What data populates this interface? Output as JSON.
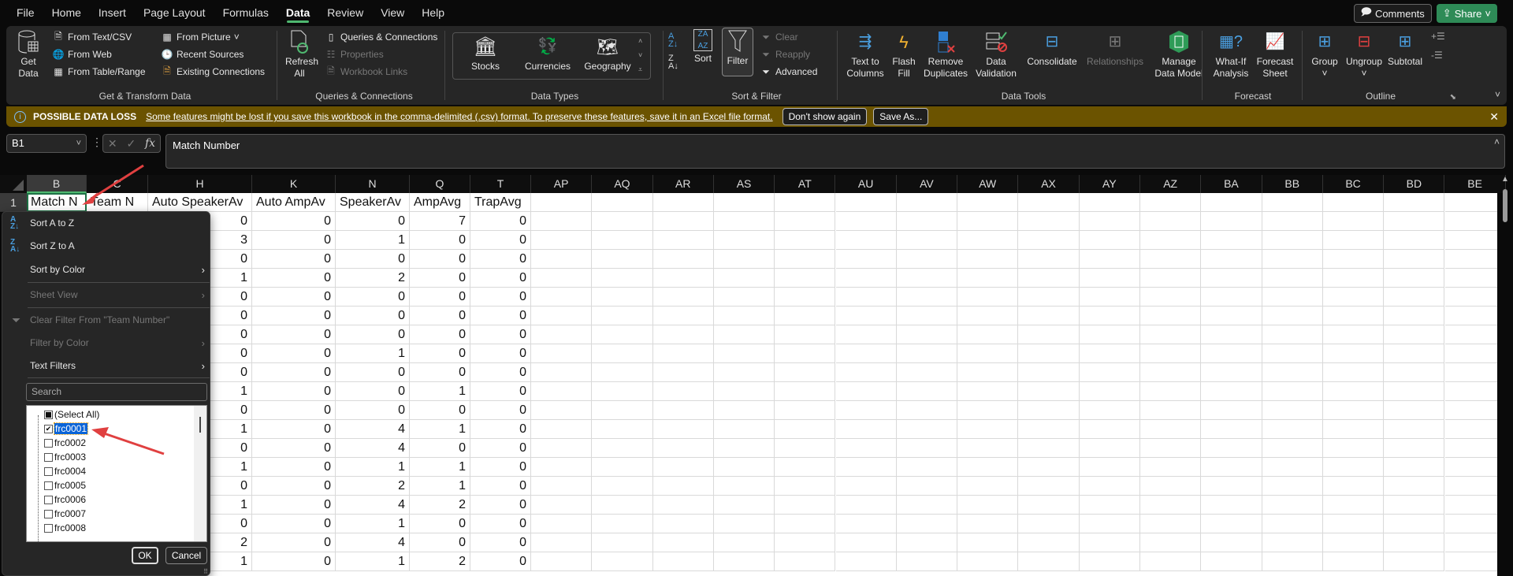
{
  "menubar": {
    "tabs": [
      "File",
      "Home",
      "Insert",
      "Page Layout",
      "Formulas",
      "Data",
      "Review",
      "View",
      "Help"
    ],
    "active_tab": "Data",
    "comments_label": "Comments",
    "share_label": "Share"
  },
  "ribbon": {
    "get_transform": {
      "label": "Get & Transform Data",
      "get_data": "Get Data",
      "from_text_csv": "From Text/CSV",
      "from_web": "From Web",
      "from_table_range": "From Table/Range",
      "from_picture": "From Picture",
      "recent_sources": "Recent Sources",
      "existing_connections": "Existing Connections"
    },
    "queries": {
      "label": "Queries & Connections",
      "refresh_all": "Refresh All",
      "queries_connections": "Queries & Connections",
      "properties": "Properties",
      "workbook_links": "Workbook Links"
    },
    "data_types": {
      "label": "Data Types",
      "stocks": "Stocks",
      "currencies": "Currencies",
      "geography": "Geography"
    },
    "sort_filter": {
      "label": "Sort & Filter",
      "sort": "Sort",
      "filter": "Filter",
      "clear": "Clear",
      "reapply": "Reapply",
      "advanced": "Advanced"
    },
    "data_tools": {
      "label": "Data Tools",
      "text_to_columns": "Text to Columns",
      "flash_fill": "Flash Fill",
      "remove_duplicates": "Remove Duplicates",
      "data_validation": "Data Validation",
      "consolidate": "Consolidate",
      "relationships": "Relationships",
      "manage_data_model": "Manage Data Model"
    },
    "forecast": {
      "label": "Forecast",
      "what_if": "What-If Analysis",
      "forecast_sheet": "Forecast Sheet"
    },
    "outline": {
      "label": "Outline",
      "group": "Group",
      "ungroup": "Ungroup",
      "subtotal": "Subtotal"
    }
  },
  "warning": {
    "title": "POSSIBLE DATA LOSS",
    "message": "Some features might be lost if you save this workbook in the comma-delimited (.csv) format. To preserve these features, save it in an Excel file format.",
    "dont_show": "Don't show again",
    "save_as": "Save As..."
  },
  "formula_bar": {
    "name_box": "B1",
    "fx": "fx",
    "value": "Match Number"
  },
  "sheet": {
    "columns": [
      "B",
      "C",
      "H",
      "K",
      "N",
      "Q",
      "T",
      "AP",
      "AQ",
      "AR",
      "AS",
      "AT",
      "AU",
      "AV",
      "AW",
      "AX",
      "AY",
      "AZ",
      "BA",
      "BB",
      "BC",
      "BD",
      "BE"
    ],
    "headers": [
      "Match N",
      "Team N",
      "Auto SpeakerAv",
      "Auto AmpAv",
      "SpeakerAv",
      "AmpAvg",
      "TrapAvg"
    ],
    "row_numbers": [
      "1"
    ],
    "rows": [
      [
        0,
        0,
        0,
        7,
        0
      ],
      [
        3,
        0,
        1,
        0,
        0
      ],
      [
        0,
        0,
        0,
        0,
        0
      ],
      [
        1,
        0,
        2,
        0,
        0
      ],
      [
        0,
        0,
        0,
        0,
        0
      ],
      [
        0,
        0,
        0,
        0,
        0
      ],
      [
        0,
        0,
        0,
        0,
        0
      ],
      [
        0,
        0,
        1,
        0,
        0
      ],
      [
        0,
        0,
        0,
        0,
        0
      ],
      [
        1,
        0,
        0,
        1,
        0
      ],
      [
        0,
        0,
        0,
        0,
        0
      ],
      [
        1,
        0,
        4,
        1,
        0
      ],
      [
        0,
        0,
        4,
        0,
        0
      ],
      [
        1,
        0,
        1,
        1,
        0
      ],
      [
        0,
        0,
        2,
        1,
        0
      ],
      [
        1,
        0,
        4,
        2,
        0
      ],
      [
        0,
        0,
        1,
        0,
        0
      ],
      [
        2,
        0,
        4,
        0,
        0
      ],
      [
        1,
        0,
        1,
        2,
        0
      ]
    ]
  },
  "filter_menu": {
    "sort_a_z": "Sort A to Z",
    "sort_z_a": "Sort Z to A",
    "sort_by_color": "Sort by Color",
    "sheet_view": "Sheet View",
    "clear_filter": "Clear Filter From \"Team Number\"",
    "filter_by_color": "Filter by Color",
    "text_filters": "Text Filters",
    "search_placeholder": "Search",
    "items": [
      {
        "label": "(Select All)",
        "state": "partial"
      },
      {
        "label": "frc0001",
        "state": "checked",
        "selected": true
      },
      {
        "label": "frc0002",
        "state": "unchecked"
      },
      {
        "label": "frc0003",
        "state": "unchecked"
      },
      {
        "label": "frc0004",
        "state": "unchecked"
      },
      {
        "label": "frc0005",
        "state": "unchecked"
      },
      {
        "label": "frc0006",
        "state": "unchecked"
      },
      {
        "label": "frc0007",
        "state": "unchecked"
      },
      {
        "label": "frc0008",
        "state": "unchecked"
      }
    ],
    "ok": "OK",
    "cancel": "Cancel"
  },
  "colors": {
    "accent_green": "#4fb870",
    "warning_bg": "#6b5300",
    "annotation_arrow": "#e04040",
    "selection_blue": "#0a64d8"
  }
}
